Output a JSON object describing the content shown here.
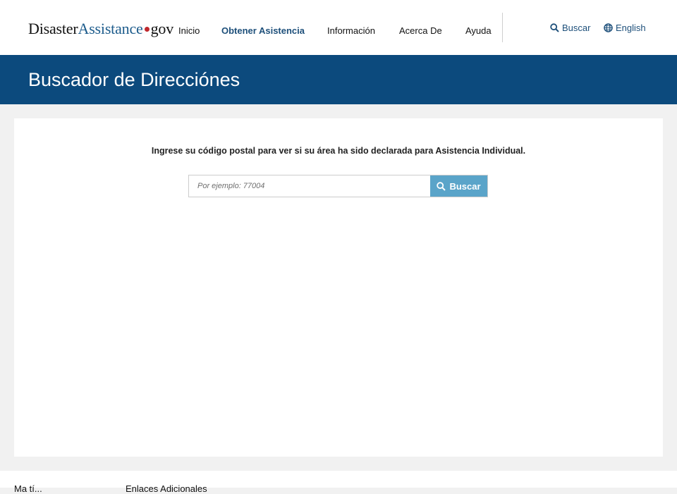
{
  "header": {
    "logo": {
      "part1": "Disaster",
      "part2": "Assistance",
      "part3": "gov"
    },
    "nav": [
      {
        "label": "Inicio"
      },
      {
        "label": "Obtener Asistencia",
        "active": true
      },
      {
        "label": "Información"
      },
      {
        "label": "Acerca De"
      },
      {
        "label": "Ayuda"
      }
    ],
    "search_label": "Buscar",
    "language_label": "English"
  },
  "banner": {
    "title": "Buscador de Direcciónes"
  },
  "main": {
    "prompt": "Ingrese su código postal para ver si su área ha sido declarada para Asistencia Individual.",
    "zip_input": {
      "placeholder": "Por ejemplo: 77004",
      "value": ""
    },
    "search_button": "Buscar"
  },
  "footer": {
    "links": [
      "Ma tí...",
      "Enlaces Adicionales"
    ]
  },
  "colors": {
    "brand_blue": "#0c4a7d",
    "button_blue": "#5aa4c9",
    "logo_red": "#c0282d"
  }
}
